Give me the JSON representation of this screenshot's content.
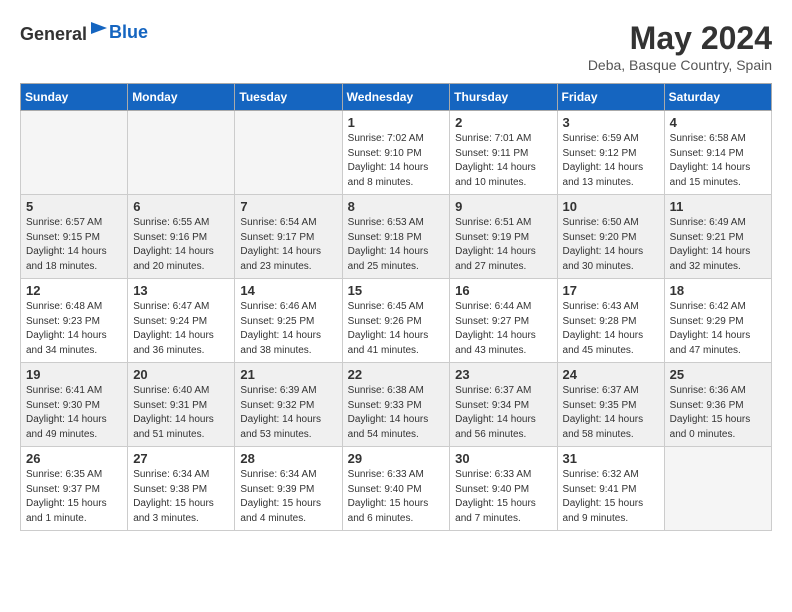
{
  "header": {
    "logo_general": "General",
    "logo_blue": "Blue",
    "title": "May 2024",
    "subtitle": "Deba, Basque Country, Spain"
  },
  "days_of_week": [
    "Sunday",
    "Monday",
    "Tuesday",
    "Wednesday",
    "Thursday",
    "Friday",
    "Saturday"
  ],
  "weeks": [
    {
      "shaded": false,
      "days": [
        {
          "num": "",
          "info": ""
        },
        {
          "num": "",
          "info": ""
        },
        {
          "num": "",
          "info": ""
        },
        {
          "num": "1",
          "info": "Sunrise: 7:02 AM\nSunset: 9:10 PM\nDaylight: 14 hours\nand 8 minutes."
        },
        {
          "num": "2",
          "info": "Sunrise: 7:01 AM\nSunset: 9:11 PM\nDaylight: 14 hours\nand 10 minutes."
        },
        {
          "num": "3",
          "info": "Sunrise: 6:59 AM\nSunset: 9:12 PM\nDaylight: 14 hours\nand 13 minutes."
        },
        {
          "num": "4",
          "info": "Sunrise: 6:58 AM\nSunset: 9:14 PM\nDaylight: 14 hours\nand 15 minutes."
        }
      ]
    },
    {
      "shaded": true,
      "days": [
        {
          "num": "5",
          "info": "Sunrise: 6:57 AM\nSunset: 9:15 PM\nDaylight: 14 hours\nand 18 minutes."
        },
        {
          "num": "6",
          "info": "Sunrise: 6:55 AM\nSunset: 9:16 PM\nDaylight: 14 hours\nand 20 minutes."
        },
        {
          "num": "7",
          "info": "Sunrise: 6:54 AM\nSunset: 9:17 PM\nDaylight: 14 hours\nand 23 minutes."
        },
        {
          "num": "8",
          "info": "Sunrise: 6:53 AM\nSunset: 9:18 PM\nDaylight: 14 hours\nand 25 minutes."
        },
        {
          "num": "9",
          "info": "Sunrise: 6:51 AM\nSunset: 9:19 PM\nDaylight: 14 hours\nand 27 minutes."
        },
        {
          "num": "10",
          "info": "Sunrise: 6:50 AM\nSunset: 9:20 PM\nDaylight: 14 hours\nand 30 minutes."
        },
        {
          "num": "11",
          "info": "Sunrise: 6:49 AM\nSunset: 9:21 PM\nDaylight: 14 hours\nand 32 minutes."
        }
      ]
    },
    {
      "shaded": false,
      "days": [
        {
          "num": "12",
          "info": "Sunrise: 6:48 AM\nSunset: 9:23 PM\nDaylight: 14 hours\nand 34 minutes."
        },
        {
          "num": "13",
          "info": "Sunrise: 6:47 AM\nSunset: 9:24 PM\nDaylight: 14 hours\nand 36 minutes."
        },
        {
          "num": "14",
          "info": "Sunrise: 6:46 AM\nSunset: 9:25 PM\nDaylight: 14 hours\nand 38 minutes."
        },
        {
          "num": "15",
          "info": "Sunrise: 6:45 AM\nSunset: 9:26 PM\nDaylight: 14 hours\nand 41 minutes."
        },
        {
          "num": "16",
          "info": "Sunrise: 6:44 AM\nSunset: 9:27 PM\nDaylight: 14 hours\nand 43 minutes."
        },
        {
          "num": "17",
          "info": "Sunrise: 6:43 AM\nSunset: 9:28 PM\nDaylight: 14 hours\nand 45 minutes."
        },
        {
          "num": "18",
          "info": "Sunrise: 6:42 AM\nSunset: 9:29 PM\nDaylight: 14 hours\nand 47 minutes."
        }
      ]
    },
    {
      "shaded": true,
      "days": [
        {
          "num": "19",
          "info": "Sunrise: 6:41 AM\nSunset: 9:30 PM\nDaylight: 14 hours\nand 49 minutes."
        },
        {
          "num": "20",
          "info": "Sunrise: 6:40 AM\nSunset: 9:31 PM\nDaylight: 14 hours\nand 51 minutes."
        },
        {
          "num": "21",
          "info": "Sunrise: 6:39 AM\nSunset: 9:32 PM\nDaylight: 14 hours\nand 53 minutes."
        },
        {
          "num": "22",
          "info": "Sunrise: 6:38 AM\nSunset: 9:33 PM\nDaylight: 14 hours\nand 54 minutes."
        },
        {
          "num": "23",
          "info": "Sunrise: 6:37 AM\nSunset: 9:34 PM\nDaylight: 14 hours\nand 56 minutes."
        },
        {
          "num": "24",
          "info": "Sunrise: 6:37 AM\nSunset: 9:35 PM\nDaylight: 14 hours\nand 58 minutes."
        },
        {
          "num": "25",
          "info": "Sunrise: 6:36 AM\nSunset: 9:36 PM\nDaylight: 15 hours\nand 0 minutes."
        }
      ]
    },
    {
      "shaded": false,
      "days": [
        {
          "num": "26",
          "info": "Sunrise: 6:35 AM\nSunset: 9:37 PM\nDaylight: 15 hours\nand 1 minute."
        },
        {
          "num": "27",
          "info": "Sunrise: 6:34 AM\nSunset: 9:38 PM\nDaylight: 15 hours\nand 3 minutes."
        },
        {
          "num": "28",
          "info": "Sunrise: 6:34 AM\nSunset: 9:39 PM\nDaylight: 15 hours\nand 4 minutes."
        },
        {
          "num": "29",
          "info": "Sunrise: 6:33 AM\nSunset: 9:40 PM\nDaylight: 15 hours\nand 6 minutes."
        },
        {
          "num": "30",
          "info": "Sunrise: 6:33 AM\nSunset: 9:40 PM\nDaylight: 15 hours\nand 7 minutes."
        },
        {
          "num": "31",
          "info": "Sunrise: 6:32 AM\nSunset: 9:41 PM\nDaylight: 15 hours\nand 9 minutes."
        },
        {
          "num": "",
          "info": ""
        }
      ]
    }
  ]
}
